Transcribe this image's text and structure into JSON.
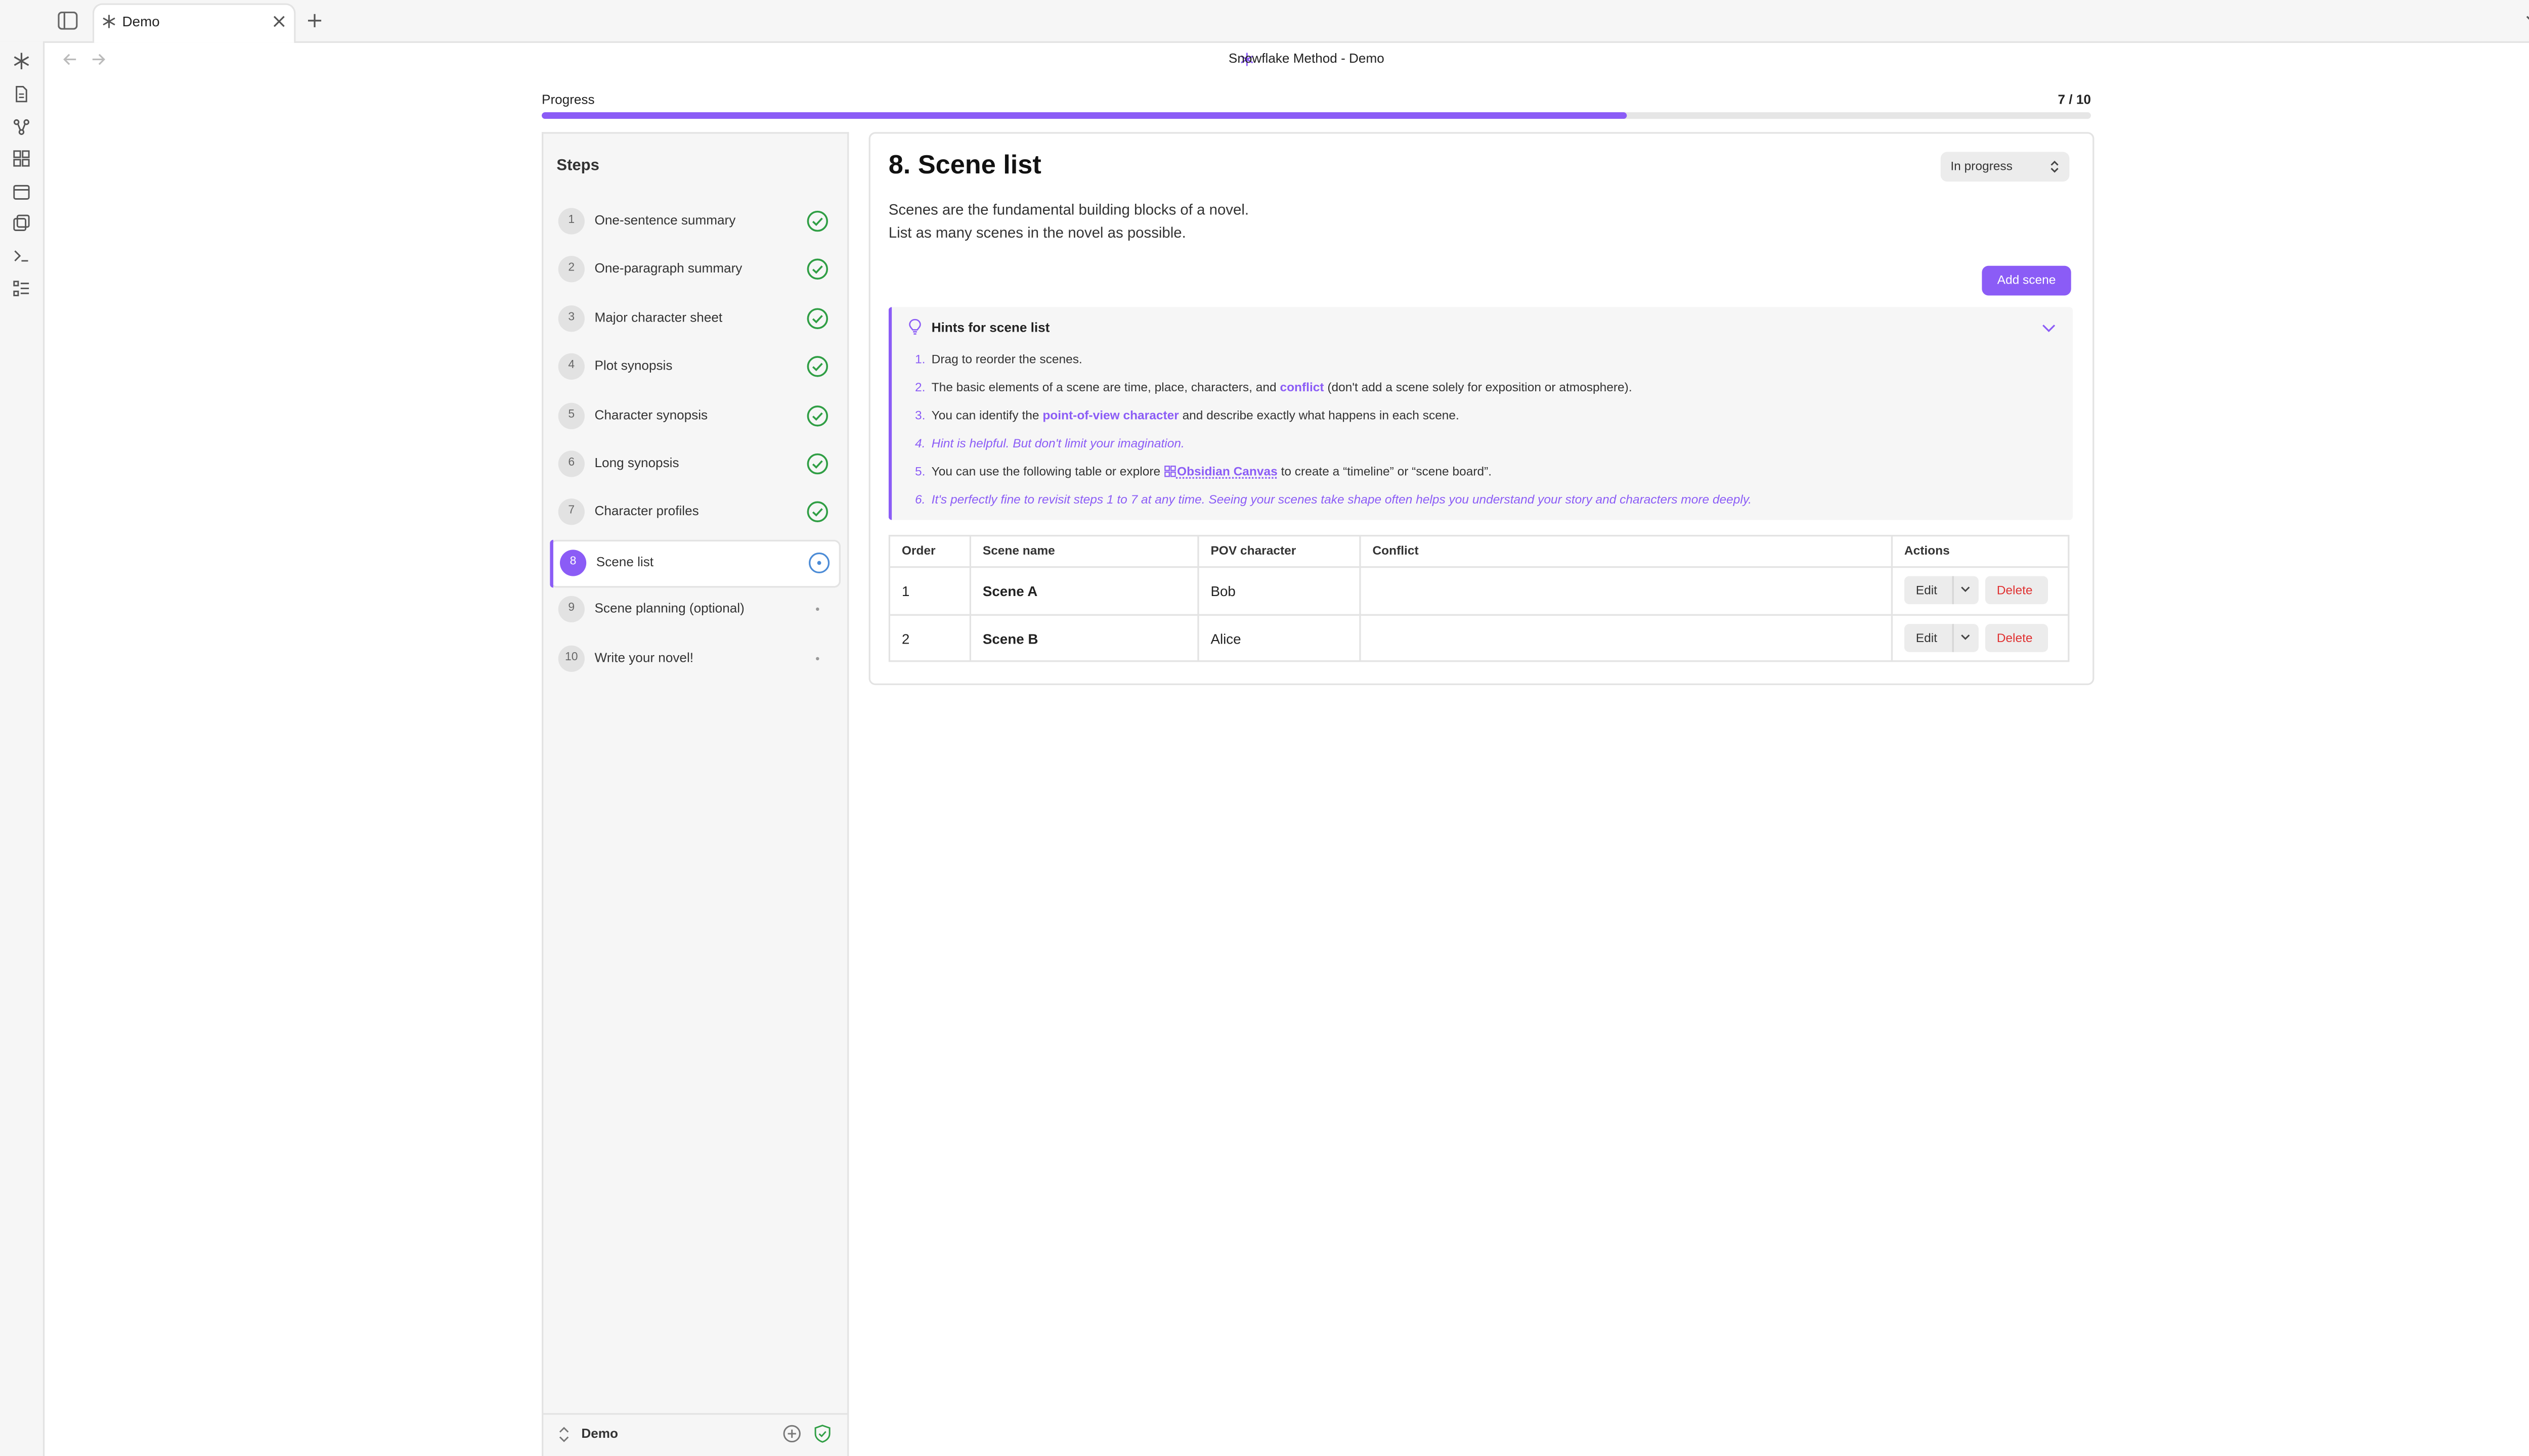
{
  "window": {
    "title": "Snowflake Method - Demo"
  },
  "tabs": [
    {
      "label": "Demo"
    }
  ],
  "progress": {
    "label": "Progress",
    "count": "7 / 10",
    "fraction": 0.7
  },
  "sidebar": {
    "heading": "Steps",
    "steps": [
      {
        "num": "1",
        "label": "One-sentence summary",
        "status": "done"
      },
      {
        "num": "2",
        "label": "One-paragraph summary",
        "status": "done"
      },
      {
        "num": "3",
        "label": "Major character sheet",
        "status": "done"
      },
      {
        "num": "4",
        "label": "Plot synopsis",
        "status": "done"
      },
      {
        "num": "5",
        "label": "Character synopsis",
        "status": "done"
      },
      {
        "num": "6",
        "label": "Long synopsis",
        "status": "done"
      },
      {
        "num": "7",
        "label": "Character profiles",
        "status": "done"
      },
      {
        "num": "8",
        "label": "Scene list",
        "status": "in-progress"
      },
      {
        "num": "9",
        "label": "Scene planning (optional)",
        "status": "pending"
      },
      {
        "num": "10",
        "label": "Write your novel!",
        "status": "pending"
      }
    ],
    "footer": {
      "vault_name": "Demo"
    }
  },
  "main": {
    "title": "8. Scene list",
    "status_value": "In progress",
    "description": [
      "Scenes are the fundamental building blocks of a novel.",
      "List as many scenes in the novel as possible."
    ],
    "add_button": "Add scene",
    "hints": {
      "title": "Hints for scene list",
      "items": [
        {
          "num": "1.",
          "text": "Drag to reorder the scenes."
        },
        {
          "num": "2.",
          "pre": "The basic elements of a scene are time, place, characters, and ",
          "highlight": "conflict",
          "post": " (don't add a scene solely for exposition or atmosphere)."
        },
        {
          "num": "3.",
          "pre": "You can identify the ",
          "highlight": "point-of-view character",
          "post": " and describe exactly what happens in each scene."
        },
        {
          "num": "4.",
          "text": "Hint is helpful. But don't limit your imagination."
        },
        {
          "num": "5.",
          "pre": "You can use the following table or explore ",
          "highlight": "Obsidian Canvas",
          "post": " to create a “timeline” or “scene board”."
        },
        {
          "num": "6.",
          "text": "It's perfectly fine to revisit steps 1 to 7 at any time. Seeing your scenes take shape often helps you understand your story and characters more deeply."
        }
      ]
    },
    "table": {
      "headers": [
        "Order",
        "Scene name",
        "POV character",
        "Conflict",
        "Actions"
      ],
      "rows": [
        {
          "order": "1",
          "name": "Scene A",
          "pov": "Bob",
          "conflict": ""
        },
        {
          "order": "2",
          "name": "Scene B",
          "pov": "Alice",
          "conflict": ""
        }
      ],
      "edit_label": "Edit",
      "delete_label": "Delete"
    }
  },
  "colors": {
    "accent": "#8b5cf6",
    "success": "#2f9e44",
    "danger": "#e03131"
  }
}
